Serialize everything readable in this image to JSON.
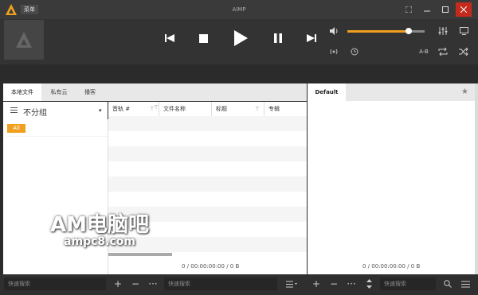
{
  "titlebar": {
    "menu_label": "菜单",
    "title": "AIMP"
  },
  "player": {
    "ab_label": "A-B",
    "volume_percent": 79
  },
  "tabs": [
    {
      "label": "本地文件"
    },
    {
      "label": "私有云"
    },
    {
      "label": "播客"
    }
  ],
  "group": {
    "label": "不分组",
    "badge": "All"
  },
  "columns": [
    {
      "label": "音轨 #"
    },
    {
      "label": "文件名称"
    },
    {
      "label": "标题"
    },
    {
      "label": "专辑"
    }
  ],
  "left_summary": "0 / 00:00:00:00 / 0 B",
  "playlist": {
    "tab_label": "Default",
    "summary": "0 / 00:00:00:00 / 0 B"
  },
  "bottombar": {
    "search1": "快速搜索",
    "search2": "快速搜索",
    "search3": "快速搜索"
  },
  "watermark": {
    "line1": "AM电脑吧",
    "line2": "ampc8.com"
  },
  "colors": {
    "accent": "#f0a020",
    "titlebar": "#3a3a3a",
    "player_bg": "#333333",
    "close": "#c42b1c"
  }
}
